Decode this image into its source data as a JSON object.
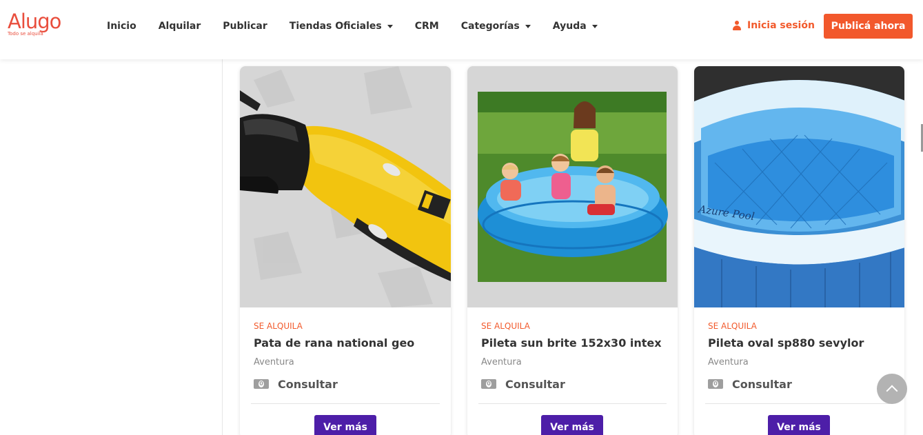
{
  "brand": {
    "name": "Alugo",
    "tagline": "Todo se alquila",
    "accent": "#f2582c",
    "secondary": "#4d1ea8"
  },
  "nav": {
    "items": [
      {
        "label": "Inicio",
        "dropdown": false
      },
      {
        "label": "Alquilar",
        "dropdown": false
      },
      {
        "label": "Publicar",
        "dropdown": false
      },
      {
        "label": "Tiendas Oficiales",
        "dropdown": true
      },
      {
        "label": "CRM",
        "dropdown": false
      },
      {
        "label": "Categorías",
        "dropdown": true
      },
      {
        "label": "Ayuda",
        "dropdown": true
      }
    ],
    "login_label": "Inicia sesión",
    "publish_label": "Publicá ahora"
  },
  "listings": [
    {
      "badge": "SE ALQUILA",
      "title": "Pata de rana national geo",
      "category": "Aventura",
      "price": "Consultar",
      "button": "Ver más",
      "image": "snorkel-fin"
    },
    {
      "badge": "SE ALQUILA",
      "title": "Pileta sun brite 152x30 intex",
      "category": "Aventura",
      "price": "Consultar",
      "button": "Ver más",
      "image": "kids-pool"
    },
    {
      "badge": "SE ALQUILA",
      "title": "Pileta oval sp880 sevylor",
      "category": "Aventura",
      "price": "Consultar",
      "button": "Ver más",
      "image": "oval-pool"
    }
  ],
  "images": {
    "oval_pool_text": "Azure Pool"
  }
}
